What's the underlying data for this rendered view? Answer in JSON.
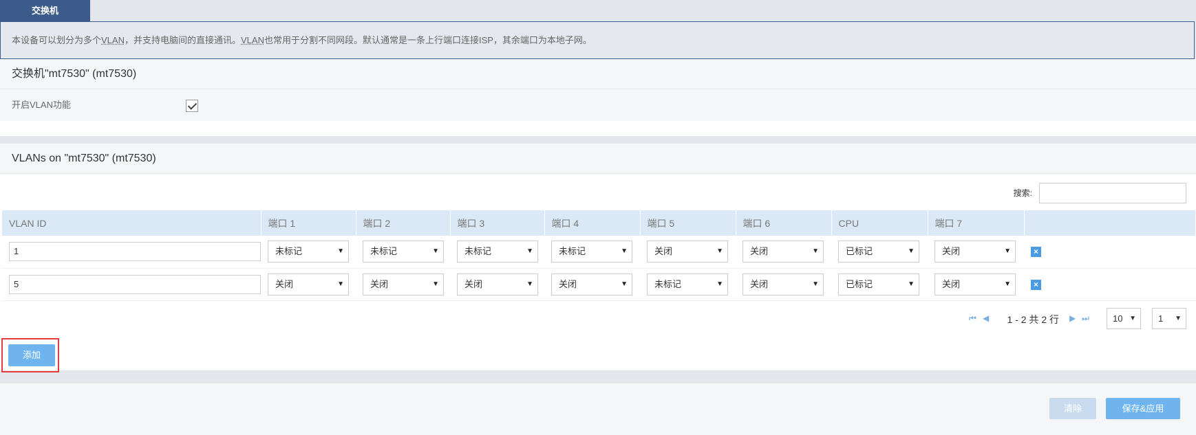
{
  "tab": {
    "label": "交换机"
  },
  "notice": {
    "part1": "本设备可以划分为多个",
    "vlan1": "VLAN",
    "part2": "，并支持电脑间的直接通讯。",
    "vlan2": "VLAN",
    "part3": "也常用于分割不同网段。默认通常是一条上行端口连接ISP，其余端口为本地子网。"
  },
  "switch_section": {
    "title": "交换机\"mt7530\" (mt7530)",
    "enable_label": "开启VLAN功能",
    "enable_checked": true
  },
  "vlans_section": {
    "title": "VLANs on \"mt7530\" (mt7530)",
    "search_label": "搜索:",
    "search_value": "",
    "columns": [
      "VLAN ID",
      "端口 1",
      "端口 2",
      "端口 3",
      "端口 4",
      "端口 5",
      "端口 6",
      "CPU",
      "端口 7",
      ""
    ],
    "rows": [
      {
        "id": "1",
        "ports": [
          "未标记",
          "未标记",
          "未标记",
          "未标记",
          "关闭",
          "关闭",
          "已标记",
          "关闭"
        ]
      },
      {
        "id": "5",
        "ports": [
          "关闭",
          "关闭",
          "关闭",
          "关闭",
          "未标记",
          "关闭",
          "已标记",
          "关闭"
        ]
      }
    ],
    "delete_symbol": "×",
    "pager": {
      "info": "1 - 2 共 2 行",
      "page_size": "10",
      "page": "1",
      "first_icon": "⏮",
      "prev_icon": "◀",
      "next_icon": "▶",
      "last_icon": "⏭"
    },
    "add_label": "添加"
  },
  "footer": {
    "clear_label": "清除",
    "save_label": "保存&应用"
  },
  "dropdown_arrow": "▼"
}
